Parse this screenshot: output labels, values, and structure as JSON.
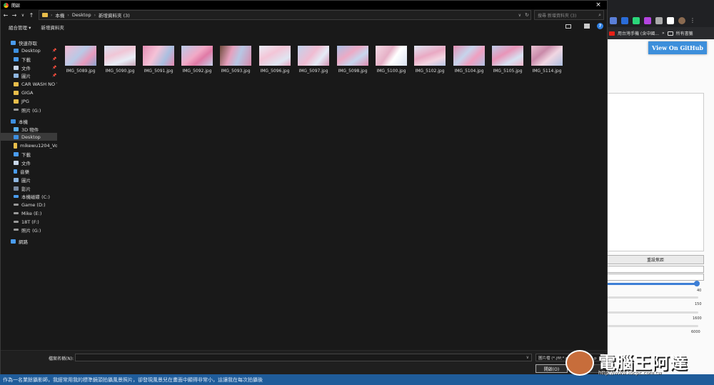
{
  "dialog": {
    "title": "開啟",
    "close_icon": "×",
    "nav": {
      "back": "←",
      "forward": "→",
      "recent": "∨",
      "up": "↑"
    },
    "breadcrumb": [
      "本機",
      "Desktop",
      "新增資料夾 (3)"
    ],
    "breadcrumb_sep": "›",
    "search_placeholder": "搜尋 新增資料夾 (3)",
    "toolbar": {
      "organize": "組合管理 ▾",
      "new_folder": "新增資料夾"
    },
    "sidebar": {
      "quick_access": "快速存取",
      "quick_items": [
        "Desktop",
        "下載",
        "文件",
        "圖片",
        "CAR WASH NO WAX",
        "GIGA",
        "JPG",
        "照片 (G:)"
      ],
      "this_pc": "本機",
      "pc_items": [
        "3D 物件",
        "Desktop",
        "下載",
        "文件",
        "音樂",
        "圖片",
        "影片",
        "本機磁碟 (C:)",
        "Game (D:)",
        "Mike (E:)",
        "18T (F:)",
        "照片 (G:)"
      ],
      "mikewu_item": "mikewu1204_Vol.1",
      "network": "網路"
    },
    "files": [
      "IMG_5089.jpg",
      "IMG_5090.jpg",
      "IMG_5091.jpg",
      "IMG_5092.jpg",
      "IMG_5093.jpg",
      "IMG_5096.jpg",
      "IMG_5097.jpg",
      "IMG_5098.jpg",
      "IMG_5100.jpg",
      "IMG_5102.jpg",
      "IMG_5104.jpg",
      "IMG_5105.jpg",
      "IMG_5114.jpg"
    ],
    "filename_label": "檔案名稱(N):",
    "filetype": "圖片檔 (*.jfif;*.pjpeg;*.jpeg;*.p",
    "open_button": "開啟(O)",
    "cancel_button": ""
  },
  "browser": {
    "bookmark_1": "用台灣手機 (含中國...",
    "bookmark_more": "»",
    "bookmark_all": "所有書籤",
    "github_button": "View On GitHub",
    "section_button": "重設焦距",
    "slider_values": [
      "40",
      "150",
      "1600",
      "6000"
    ]
  },
  "caption": "作為一名業餘攝影師，我經常用我的標準鏡頭拍攝風景照片，卻發現風景兒在畫面中顯得非常小，這讓我在每次拍攝後",
  "watermark": {
    "text": "電腦王阿達",
    "url": "http://www.kocpc.com.tw"
  },
  "colors": {
    "accent": "#3d8fdb",
    "caption_bar": "#1f5c9a",
    "folder": "#e8bd4a",
    "help": "#2f7fe0"
  }
}
